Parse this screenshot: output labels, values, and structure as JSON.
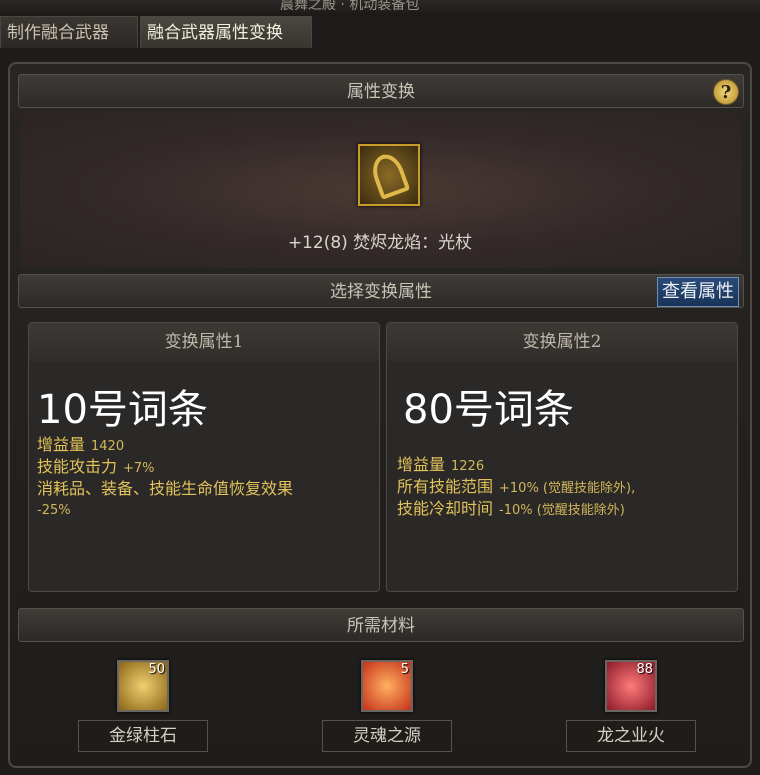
{
  "top_strip": "晨舞之殿 · 机动装备包",
  "tabs": [
    {
      "label": "制作融合武器"
    },
    {
      "label": "融合武器属性变换"
    }
  ],
  "section_attr_change": "属性变换",
  "help_symbol": "?",
  "weapon": {
    "name": "+12(8) 焚烬龙焰：光杖",
    "icon": "dragon-flame-staff-icon"
  },
  "section_select": "选择变换属性",
  "view_button": "查看属性",
  "attr1": {
    "header": "变换属性1",
    "title": "10号词条",
    "lines": [
      {
        "label": "增益量",
        "value": "1420"
      },
      {
        "label": "技能攻击力",
        "value": "+7%"
      },
      {
        "label": "消耗品、装备、技能生命值恢复效果",
        "value": ""
      },
      {
        "label": "-25%",
        "value": ""
      }
    ]
  },
  "attr2": {
    "header": "变换属性2",
    "title": "80号词条",
    "lines": [
      {
        "label": "增益量",
        "value": "1226"
      },
      {
        "label": "所有技能范围",
        "value": "+10% (觉醒技能除外),"
      },
      {
        "label": "技能冷却时间",
        "value": "-10% (觉醒技能除外)"
      }
    ]
  },
  "section_materials": "所需材料",
  "materials": [
    {
      "name": "金绿柱石",
      "count": "50",
      "icon": "gold-stone-icon",
      "color": "#d6a52a"
    },
    {
      "name": "灵魂之源",
      "count": "5",
      "icon": "soul-source-icon",
      "color": "#e8542a"
    },
    {
      "name": "龙之业火",
      "count": "88",
      "icon": "dragon-fire-icon",
      "color": "#d8304a"
    }
  ]
}
